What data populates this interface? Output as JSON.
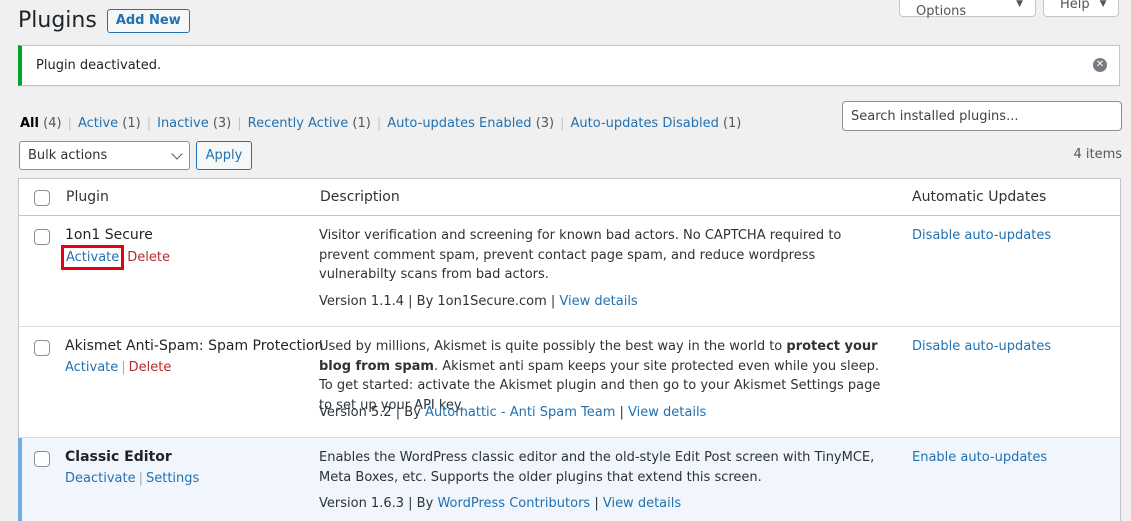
{
  "header": {
    "title": "Plugins",
    "add_new": "Add New",
    "screen_options": "Screen Options",
    "help": "Help"
  },
  "notice": {
    "text": "Plugin deactivated.",
    "dismiss_icon": "close-circle-icon"
  },
  "filters": [
    {
      "label": "All",
      "count": "(4)"
    },
    {
      "label": "Active",
      "count": "(1)"
    },
    {
      "label": "Inactive",
      "count": "(3)"
    },
    {
      "label": "Recently Active",
      "count": "(1)"
    },
    {
      "label": "Auto-updates Enabled",
      "count": "(3)"
    },
    {
      "label": "Auto-updates Disabled",
      "count": "(1)"
    }
  ],
  "search": {
    "placeholder": "Search installed plugins..."
  },
  "bulk": {
    "selected": "Bulk actions",
    "apply": "Apply",
    "items_count": "4 items"
  },
  "table": {
    "headers": {
      "plugin": "Plugin",
      "description": "Description",
      "auto_updates": "Automatic Updates"
    },
    "rows": [
      {
        "name": "1on1 Secure",
        "action1": "Activate",
        "action2": "Delete",
        "description": "Visitor verification and screening for known bad actors. No CAPTCHA required to prevent comment spam, prevent contact page spam, and reduce wordpress vulnerabilty scans from bad actors.",
        "version": "Version 1.1.4",
        "by": "By 1on1Secure.com",
        "view_details": "View details",
        "auto_update": "Disable auto-updates"
      },
      {
        "name": "Akismet Anti-Spam: Spam Protection",
        "action1": "Activate",
        "action2": "Delete",
        "desc_pre": "Used by millions, Akismet is quite possibly the best way in the world to ",
        "desc_bold": "protect your blog from spam",
        "desc_post": ". Akismet anti spam keeps your site protected even while you sleep. To get started: activate the Akismet plugin and then go to your Akismet Settings page to set up your API key.",
        "version": "Version 5.2",
        "by_prefix": "By",
        "author": "Automattic - Anti Spam Team",
        "view_details": "View details",
        "auto_update": "Disable auto-updates"
      },
      {
        "name": "Classic Editor",
        "action1": "Deactivate",
        "action2": "Settings",
        "description": "Enables the WordPress classic editor and the old-style Edit Post screen with TinyMCE, Meta Boxes, etc. Supports the older plugins that extend this screen.",
        "version": "Version 1.6.3",
        "by_prefix": "By",
        "author": "WordPress Contributors",
        "view_details": "View details",
        "auto_update": "Enable auto-updates"
      }
    ]
  },
  "colors": {
    "accent": "#2271b1",
    "success": "#00a32a",
    "delete": "#b32d2e",
    "highlight": "#e60012",
    "active_row": "#f0f6fc"
  }
}
